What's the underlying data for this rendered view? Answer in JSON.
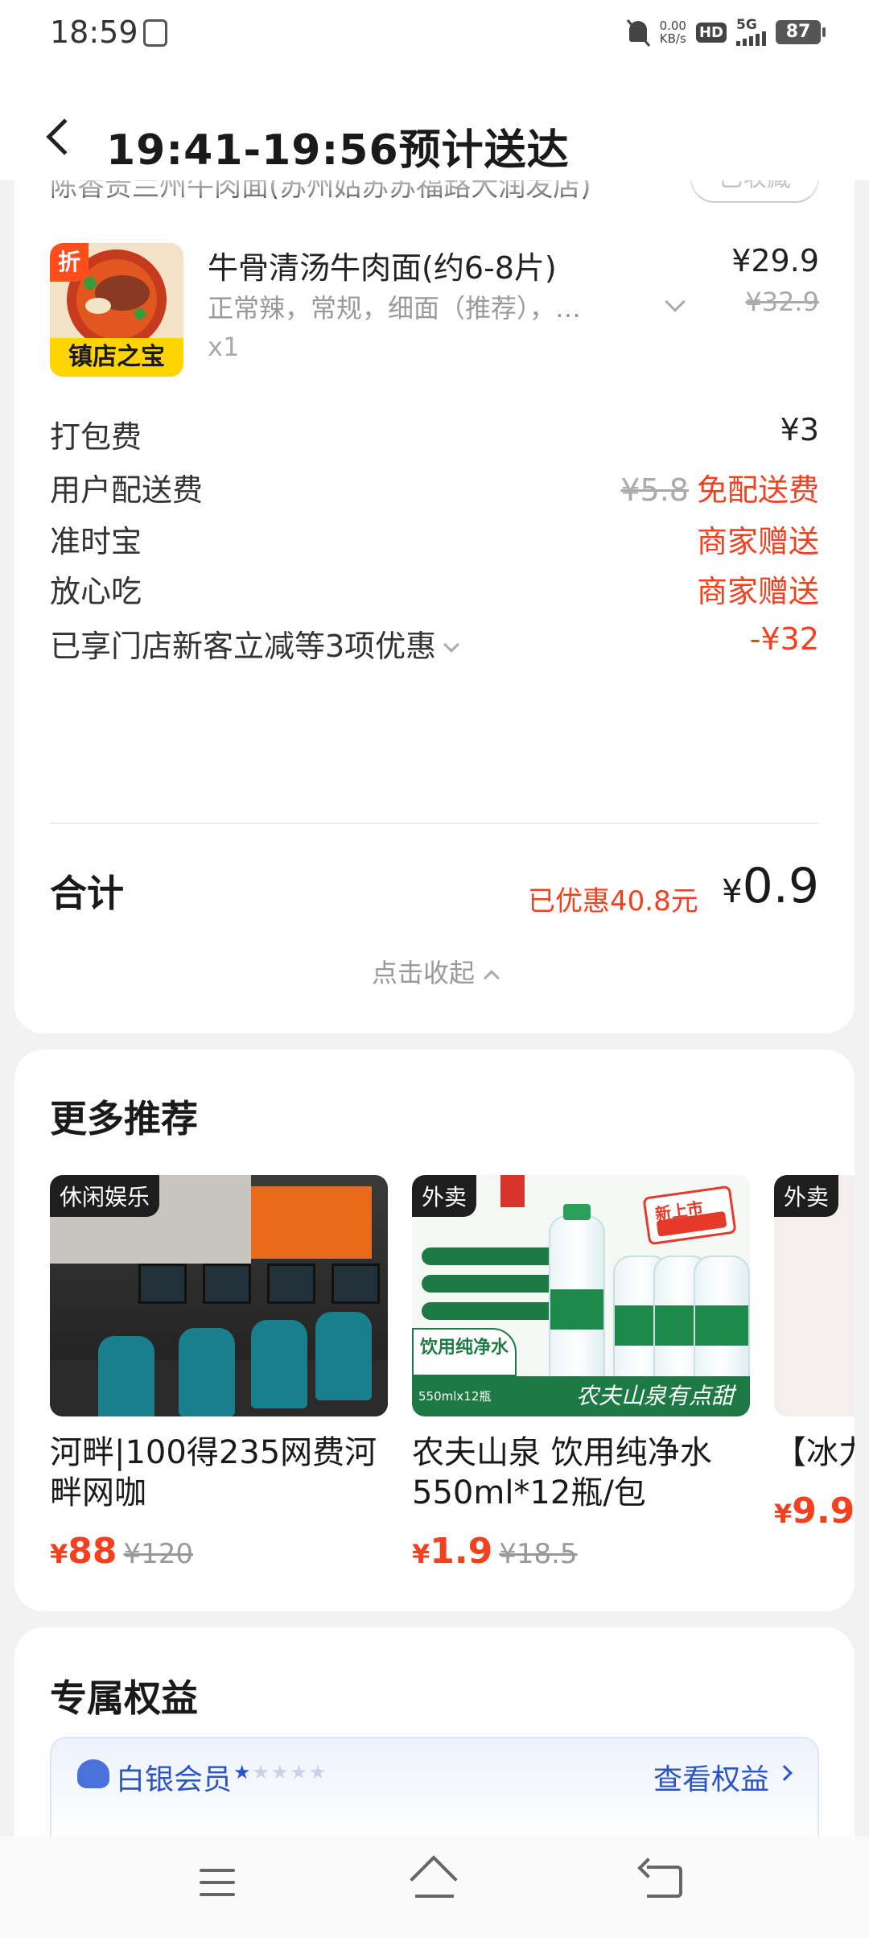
{
  "status_bar": {
    "time": "18:59",
    "net_speed_value": "0.00",
    "net_speed_unit": "KB/s",
    "hd": "HD",
    "network": "5G",
    "battery": "87"
  },
  "header": {
    "title": "19:41-19:56预计送达"
  },
  "order": {
    "shop_name": "陈香贵兰州牛肉面(苏州姑苏苏福路大润发店)",
    "collect_label": "已收藏",
    "product": {
      "image_badge": "镇店之宝",
      "discount_tag": "折",
      "name": "牛骨清汤牛肉面(约6-8片)",
      "spec": "正常辣，常规，细面（推荐），…",
      "qty": "x1",
      "price": "¥29.9",
      "original_price": "¥32.9"
    },
    "fees": [
      {
        "label": "打包费",
        "value": "¥3",
        "strike": ""
      },
      {
        "label": "用户配送费",
        "value": "免配送费",
        "strike": "¥5.8"
      },
      {
        "label": "准时宝",
        "value": "商家赠送",
        "strike": ""
      },
      {
        "label": "放心吃",
        "value": "商家赠送",
        "strike": ""
      }
    ],
    "discount_label": "已享门店新客立减等3项优惠",
    "discount_value": "-¥32",
    "total_label": "合计",
    "total_saved": "已优惠40.8元",
    "total_yen": "¥",
    "total_amount": "0.9",
    "collapse_label": "点击收起"
  },
  "recommend": {
    "title": "更多推荐",
    "items": [
      {
        "tag": "休闲娱乐",
        "name": "河畔|100得235网费河畔网咖",
        "yen": "¥",
        "price": "88",
        "old_price": "¥120"
      },
      {
        "tag": "外卖",
        "name": "农夫山泉 饮用纯净水550ml*12瓶/包",
        "yen": "¥",
        "price": "1.9",
        "old_price": "¥18.5"
      },
      {
        "tag": "外卖",
        "name": "【冰力西瓜杯",
        "yen": "¥",
        "price": "9.9",
        "old_price": ""
      }
    ],
    "water_brand_slogan": "农夫山泉有点甜",
    "water_new_label": "新上市",
    "water_drink_label": "饮用纯净水",
    "water_size_label": "550mlx12瓶"
  },
  "benefits": {
    "title": "专属权益",
    "member_name": "白银会员",
    "stars_on": "★",
    "stars_off": "★★★★",
    "link_label": "查看权益"
  },
  "colors": {
    "accent_red": "#f5401f",
    "member_blue": "#2b55c7"
  }
}
